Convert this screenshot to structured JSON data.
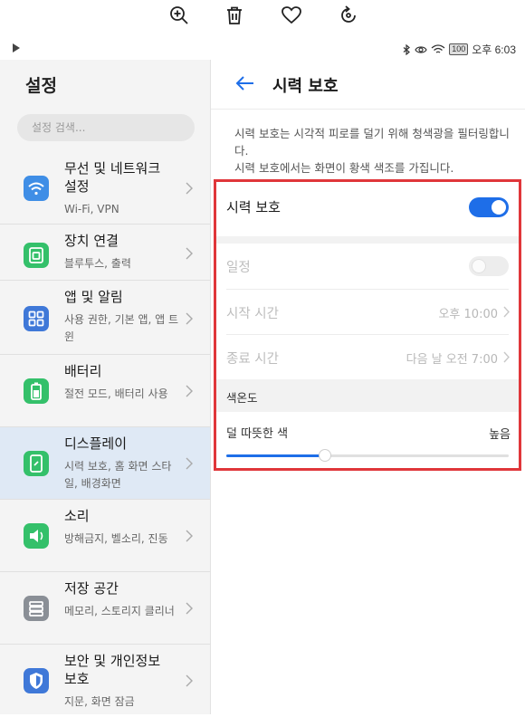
{
  "toolbar": {
    "icons": [
      "zoom-in-icon",
      "trash-icon",
      "heart-icon",
      "rotate-icon"
    ]
  },
  "statusbar": {
    "time": "오후 6:03",
    "battery": "100"
  },
  "left_panel": {
    "title": "설정",
    "search_placeholder": "설정 검색...",
    "items": [
      {
        "title": "무선 및 네트워크 설정",
        "subtitle": "Wi-Fi, VPN",
        "icon": "wifi-icon",
        "icon_color": "#3f8ee6"
      },
      {
        "title": "장치 연결",
        "subtitle": "블루투스, 출력",
        "icon": "device-connection-icon",
        "icon_color": "#34c06a"
      },
      {
        "title": "앱 및 알림",
        "subtitle": "사용 권한, 기본 앱, 앱 트윈",
        "icon": "apps-icon",
        "icon_color": "#3f78d8"
      },
      {
        "title": "배터리",
        "subtitle": "절전 모드, 배터리 사용",
        "icon": "battery-icon",
        "icon_color": "#34c06a"
      },
      {
        "title": "디스플레이",
        "subtitle": "시력 보호, 홈 화면 스타일, 배경화면",
        "icon": "display-icon",
        "icon_color": "#34c06a",
        "selected": true
      },
      {
        "title": "소리",
        "subtitle": "방해금지, 벨소리, 진동",
        "icon": "sound-icon",
        "icon_color": "#34c06a"
      },
      {
        "title": "저장 공간",
        "subtitle": "메모리, 스토리지 클리너",
        "icon": "storage-icon",
        "icon_color": "#8a8f96"
      },
      {
        "title": "보안 및 개인정보 보호",
        "subtitle": "지문, 화면 잠금",
        "icon": "shield-icon",
        "icon_color": "#3f78d8"
      }
    ]
  },
  "right_panel": {
    "title": "시력 보호",
    "description": "시력 보호는 시각적 피로를 덜기 위해 청색광을 필터링합니다.\n시력 보호에서는 화면이 황색 색조를 가집니다.",
    "eye_comfort": {
      "label": "시력 보호",
      "enabled": true
    },
    "schedule": {
      "label": "일정",
      "enabled": false
    },
    "start_time": {
      "label": "시작 시간",
      "value": "오후 10:00"
    },
    "end_time": {
      "label": "종료 시간",
      "value": "다음 날 오전 7:00"
    },
    "color_temp": {
      "section_label": "색온도",
      "left_label": "덜 따뜻한 색",
      "right_label": "높음",
      "level": 0.35
    }
  },
  "colors": {
    "accent": "#1e6ee8",
    "highlight": "#e0363a",
    "selected_bg": "#dfe9f5"
  }
}
